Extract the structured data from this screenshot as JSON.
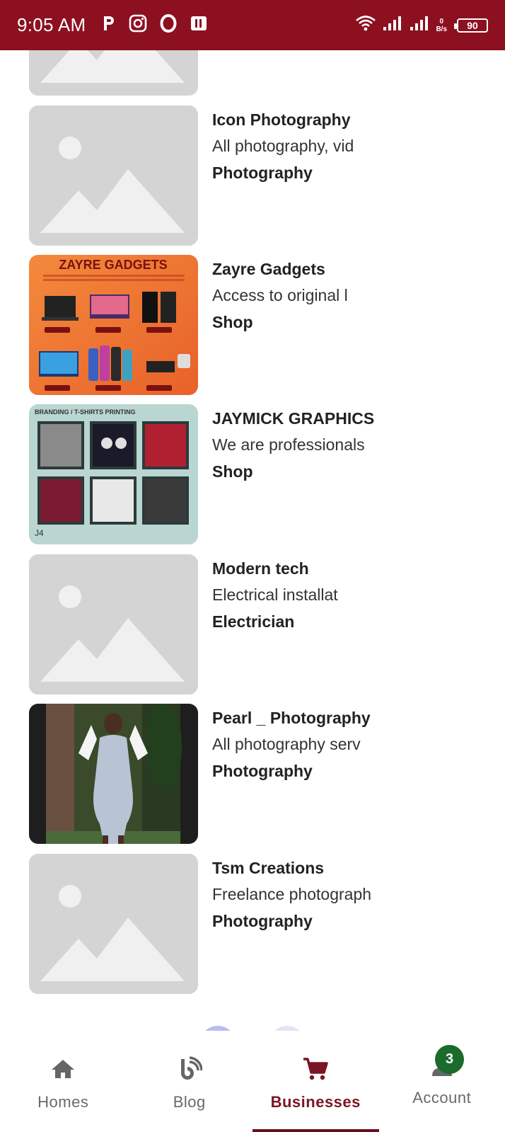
{
  "status_bar": {
    "time": "9:05 AM",
    "net_speed_value": "0",
    "net_speed_unit": "B/s",
    "battery": "90",
    "icons": [
      "p-icon",
      "instagram-icon",
      "opera-icon",
      "app-icon",
      "wifi-icon",
      "signal-icon",
      "signal-icon"
    ]
  },
  "businesses": [
    {
      "name": "",
      "description": "",
      "category": "",
      "image": "placeholder"
    },
    {
      "name": "Icon Photography",
      "description": "All photography, vid",
      "category": "Photography",
      "image": "placeholder"
    },
    {
      "name": "Zayre Gadgets",
      "description": "Access to original l",
      "category": "Shop",
      "image": "zayre-gadgets-banner",
      "image_text": "ZAYRE GADGETS"
    },
    {
      "name": "JAYMICK GRAPHICS",
      "description": "We are professionals",
      "category": "Shop",
      "image": "tshirt-printing-collage",
      "image_text": "BRANDING / T-SHIRTS PRINTING"
    },
    {
      "name": "Modern tech",
      "description": "Electrical installat",
      "category": "Electrician",
      "image": "placeholder"
    },
    {
      "name": "Pearl _ Photography",
      "description": "All photography serv",
      "category": "Photography",
      "image": "portrait-photo"
    },
    {
      "name": "Tsm Creations",
      "description": "Freelance photograph",
      "category": "Photography",
      "image": "placeholder"
    }
  ],
  "bottom_nav": {
    "items": [
      {
        "label": "Homes",
        "icon": "home-icon"
      },
      {
        "label": "Blog",
        "icon": "blog-icon"
      },
      {
        "label": "Businesses",
        "icon": "cart-icon",
        "active": true
      },
      {
        "label": "Account",
        "icon": "account-icon",
        "badge": "3"
      }
    ]
  },
  "colors": {
    "status_bar": "#8c1020",
    "active_nav": "#7a1624",
    "badge": "#1b6b2c",
    "placeholder": "#d4d4d4"
  }
}
